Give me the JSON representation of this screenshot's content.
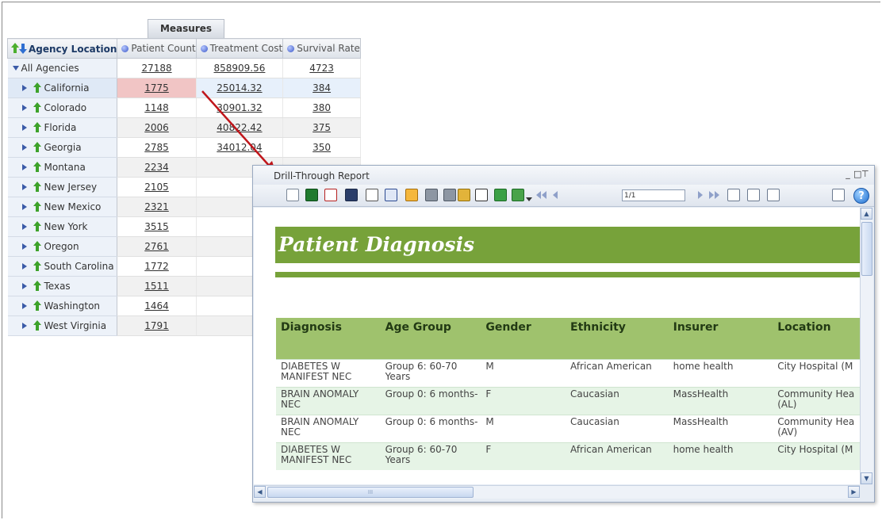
{
  "pivot": {
    "measures_header": "Measures",
    "location_header": "Agency Location",
    "columns": [
      "Patient Count",
      "Treatment Cost",
      "Survival Rate"
    ],
    "total_row": {
      "label": "All Agencies",
      "values": [
        "27188",
        "858909.56",
        "4723"
      ]
    },
    "rows": [
      {
        "label": "California",
        "values": [
          "1775",
          "25014.32",
          "384"
        ]
      },
      {
        "label": "Colorado",
        "values": [
          "1148",
          "30901.32",
          "380"
        ]
      },
      {
        "label": "Florida",
        "values": [
          "2006",
          "40822.42",
          "375"
        ]
      },
      {
        "label": "Georgia",
        "values": [
          "2785",
          "34012.04",
          "350"
        ]
      },
      {
        "label": "Montana",
        "values": [
          "2234",
          "",
          ""
        ]
      },
      {
        "label": "New Jersey",
        "values": [
          "2105",
          "",
          ""
        ]
      },
      {
        "label": "New Mexico",
        "values": [
          "2321",
          "",
          ""
        ]
      },
      {
        "label": "New York",
        "values": [
          "3515",
          "",
          ""
        ]
      },
      {
        "label": "Oregon",
        "values": [
          "2761",
          "",
          ""
        ]
      },
      {
        "label": "South Carolina",
        "values": [
          "1772",
          "",
          ""
        ]
      },
      {
        "label": "Texas",
        "values": [
          "1511",
          "",
          ""
        ]
      },
      {
        "label": "Washington",
        "values": [
          "1464",
          "",
          ""
        ]
      },
      {
        "label": "West Virginia",
        "values": [
          "1791",
          "",
          ""
        ]
      }
    ]
  },
  "drill": {
    "window_title": "Drill-Through Report",
    "window_buttons": {
      "minimize": "_",
      "maximize": "□",
      "pin": "ᚁ"
    },
    "page_indicator": "1/1",
    "help_label": "?",
    "report_title": "Patient Diagnosis",
    "headers": [
      "Diagnosis",
      "Age Group",
      "Gender",
      "Ethnicity",
      "Insurer",
      "Location"
    ],
    "rows": [
      [
        "DIABETES W MANIFEST NEC",
        "Group 6: 60-70 Years",
        "M",
        "African American",
        "home health",
        "City Hospital (M"
      ],
      [
        "BRAIN ANOMALY NEC",
        "Group 0: 6 months-",
        "F",
        "Caucasian",
        "MassHealth",
        "Community Hea (AL)"
      ],
      [
        "BRAIN ANOMALY NEC",
        "Group 0: 6 months-",
        "M",
        "Caucasian",
        "MassHealth",
        "Community Hea (AV)"
      ],
      [
        "DIABETES W MANIFEST NEC",
        "Group 6: 60-70 Years",
        "F",
        "African American",
        "home health",
        "City Hospital (M"
      ]
    ],
    "scroll_labels": {
      "up": "▲",
      "down": "▼",
      "left": "◀",
      "right": "▶",
      "grip": "III",
      "vgrip": "≡"
    }
  },
  "colors": {
    "banner": "#77a23a",
    "header_green": "#9fc26d",
    "row_green": "#e6f4e6",
    "highlight_cell": "#f1c5c5",
    "arrow_red": "#c0161b"
  },
  "icons": {
    "toolbar": [
      "list-icon",
      "excel-icon",
      "pdf-icon",
      "csv-icon",
      "text-icon",
      "word-icon",
      "copy-icon",
      "print-icon",
      "print-setup-icon",
      "lock-icon",
      "email-icon",
      "save-icon",
      "refresh-icon",
      "first-page-icon",
      "prev-page-icon",
      "next-page-icon",
      "last-page-icon",
      "edit-icon",
      "properties-icon",
      "export-icon",
      "notes-icon",
      "help-icon"
    ]
  }
}
